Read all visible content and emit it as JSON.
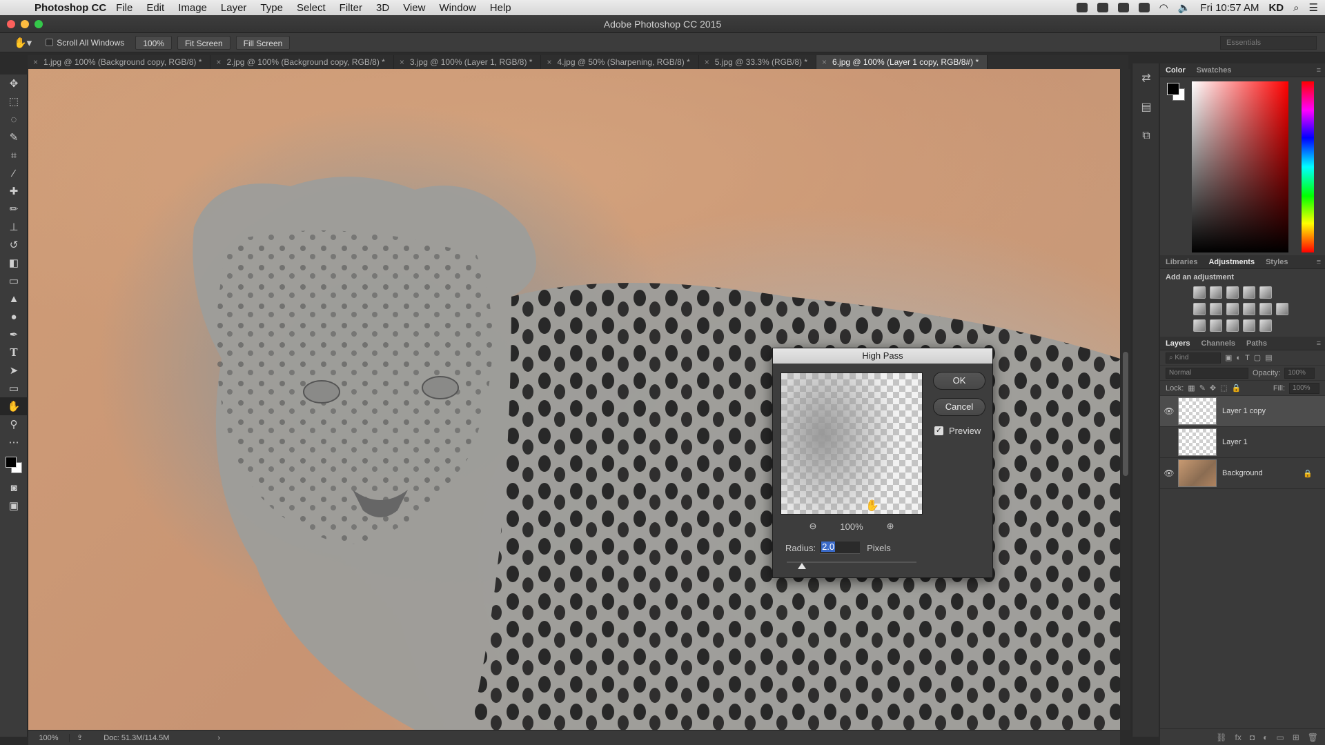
{
  "menubar": {
    "app_name": "Photoshop CC",
    "menus": [
      "File",
      "Edit",
      "Image",
      "Layer",
      "Type",
      "Select",
      "Filter",
      "3D",
      "View",
      "Window",
      "Help"
    ],
    "clock": "Fri 10:57 AM",
    "user": "KD"
  },
  "window": {
    "title": "Adobe Photoshop CC 2015"
  },
  "options": {
    "scroll_all_windows": "Scroll All Windows",
    "zoom": "100%",
    "fit_screen": "Fit Screen",
    "fill_screen": "Fill Screen",
    "workspace": "Essentials"
  },
  "tabs": [
    "1.jpg @ 100% (Background copy, RGB/8) *",
    "2.jpg @ 100% (Background copy, RGB/8) *",
    "3.jpg @ 100% (Layer 1, RGB/8) *",
    "4.jpg @ 50% (Sharpening, RGB/8) *",
    "5.jpg @ 33.3% (RGB/8) *",
    "6.jpg @ 100% (Layer 1 copy, RGB/8#) *"
  ],
  "status": {
    "zoom": "100%",
    "doc": "Doc: 51.3M/114.5M"
  },
  "panels": {
    "color_tabs": [
      "Color",
      "Swatches"
    ],
    "adj_tabs": [
      "Libraries",
      "Adjustments",
      "Styles"
    ],
    "adj_caption": "Add an adjustment",
    "layer_tabs": [
      "Layers",
      "Channels",
      "Paths"
    ],
    "kind_placeholder": "Kind",
    "blend_mode": "Normal",
    "opacity_label": "Opacity:",
    "opacity_value": "100%",
    "lock_label": "Lock:",
    "fill_label": "Fill:",
    "fill_value": "100%",
    "layers": [
      {
        "name": "Layer 1 copy",
        "visible": true
      },
      {
        "name": "Layer 1",
        "visible": false
      },
      {
        "name": "Background",
        "visible": true
      }
    ]
  },
  "dialog": {
    "title": "High Pass",
    "ok": "OK",
    "cancel": "Cancel",
    "preview": "Preview",
    "zoom": "100%",
    "radius_label": "Radius:",
    "radius_value": "2.0",
    "radius_unit": "Pixels"
  }
}
